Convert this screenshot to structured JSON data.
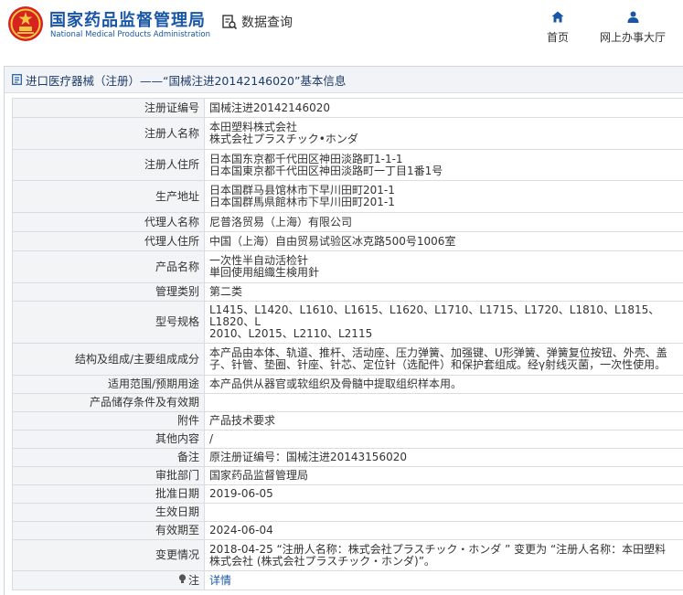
{
  "header": {
    "logo_cn": "国家药品监督管理局",
    "logo_en": "National Medical Products Administration",
    "data_query": "数据查询",
    "nav": [
      {
        "label": "首页",
        "icon": "home-icon"
      },
      {
        "label": "网上办事大厅",
        "icon": "user-icon"
      }
    ]
  },
  "panel": {
    "title": "进口医疗器械（注册）——“国械注进20142146020”基本信息"
  },
  "rows": [
    {
      "label": "注册证编号",
      "lines": [
        "国械注进20142146020"
      ]
    },
    {
      "label": "注册人名称",
      "lines": [
        "本田塑料株式会社",
        "株式会社プラスチック•ホンダ"
      ]
    },
    {
      "label": "注册人住所",
      "lines": [
        "日本国东京都千代田区神田淡路町1-1-1",
        "日本国東京都千代田区神田淡路町一丁目1番1号"
      ]
    },
    {
      "label": "生产地址",
      "lines": [
        "日本国群马县馆林市下早川田町201-1",
        "日本国群馬県館林市下早川田町201-1"
      ]
    },
    {
      "label": "代理人名称",
      "lines": [
        "尼普洛贸易（上海）有限公司"
      ]
    },
    {
      "label": "代理人住所",
      "lines": [
        "中国（上海）自由贸易试验区冰克路500号1006室"
      ]
    },
    {
      "label": "产品名称",
      "lines": [
        "一次性半自动活检针",
        "単回使用組織生検用針"
      ]
    },
    {
      "label": "管理类别",
      "lines": [
        "第二类"
      ]
    },
    {
      "label": "型号规格",
      "lines": [
        "L1415、L1420、L1610、L1615、L1620、L1710、L1715、L1720、L1810、L1815、L1820、L",
        "2010、L2015、L2110、L2115"
      ]
    },
    {
      "label": "结构及组成/主要组成成分",
      "lines": [
        "本产品由本体、轨道、推杆、活动座、压力弹簧、加强键、U形弹簧、弹簧复位按钮、外壳、盖",
        "子、针管、垫圈、针座、针芯、定位针（选配件）和保护套组成。经γ射线灭菌，一次性使用。"
      ]
    },
    {
      "label": "适用范围/预期用途",
      "lines": [
        "本产品供从器官或软组织及骨髓中提取组织样本用。"
      ]
    },
    {
      "label": "产品储存条件及有效期",
      "lines": [
        ""
      ]
    },
    {
      "label": "附件",
      "lines": [
        "产品技术要求"
      ]
    },
    {
      "label": "其他内容",
      "lines": [
        "/"
      ]
    },
    {
      "label": "备注",
      "lines": [
        "原注册证编号：国械注进20143156020"
      ]
    },
    {
      "label": "审批部门",
      "lines": [
        "国家药品监督管理局"
      ]
    },
    {
      "label": "批准日期",
      "lines": [
        "2019-06-05"
      ]
    },
    {
      "label": "生效日期",
      "lines": [
        ""
      ]
    },
    {
      "label": "有效期至",
      "lines": [
        "2024-06-04"
      ]
    },
    {
      "label": "变更情况",
      "lines": [
        "2018-04-25 “注册人名称：株式会社プラスチック・ホンダ ” 变更为 “注册人名称：本田塑料",
        "株式会社 (株式会社プラスチック・ホンダ)”。"
      ]
    },
    {
      "label": "注",
      "lines": [
        "详情"
      ],
      "link": true,
      "label_icon": "lightbulb-icon"
    }
  ],
  "colors": {
    "brand": "#1957a6",
    "label_bg": "#f3f4f6",
    "border": "#d8dde4"
  }
}
